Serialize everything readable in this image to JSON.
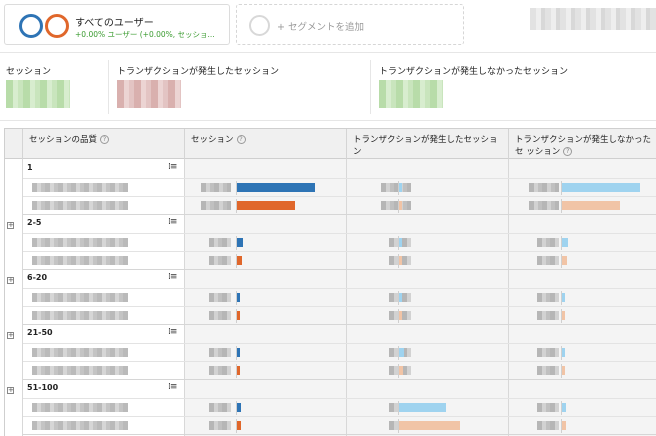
{
  "segments": {
    "active": {
      "name": "すべてのユーザー",
      "stats": "+0.00% ユーザー (+0.00%, セッショ...",
      "colors": [
        "#2e74b5",
        "#e0672b"
      ]
    },
    "add_label": "+ セグメントを追加"
  },
  "summary": [
    {
      "label": "セッション",
      "color": "green"
    },
    {
      "label": "トランザクションが発生したセッション",
      "color": "red"
    },
    {
      "label": "トランザクションが発生しなかったセッション",
      "color": "green"
    }
  ],
  "table": {
    "headers": [
      "セッションの品質",
      "セッション",
      "トランザクションが発生したセッション",
      "トランザクションが発生しなかったセ ッション"
    ],
    "help_icon": "?",
    "groups": [
      {
        "label": "1",
        "bars": {
          "sessions": [
            0.78,
            0.58
          ],
          "with_tx": [
            0.04,
            0.03
          ],
          "without_tx": [
            0.78,
            0.58
          ]
        }
      },
      {
        "label": "2-5",
        "bars": {
          "sessions": [
            0.06,
            0.05
          ],
          "with_tx": [
            0.02,
            0.02
          ],
          "without_tx": [
            0.06,
            0.05
          ]
        }
      },
      {
        "label": "6-20",
        "bars": {
          "sessions": [
            0.03,
            0.03
          ],
          "with_tx": [
            0.02,
            0.02
          ],
          "without_tx": [
            0.03,
            0.03
          ]
        }
      },
      {
        "label": "21-50",
        "bars": {
          "sessions": [
            0.03,
            0.03
          ],
          "with_tx": [
            0.06,
            0.05
          ],
          "without_tx": [
            0.03,
            0.03
          ]
        }
      },
      {
        "label": "51-100",
        "bars": {
          "sessions": [
            0.04,
            0.04
          ],
          "with_tx": [
            0.6,
            0.78
          ],
          "without_tx": [
            0.04,
            0.04
          ]
        }
      }
    ],
    "colors": {
      "blue_dark": "#2e74b5",
      "orange_dark": "#e0672b",
      "blue_light": "#9fd3ef",
      "orange_light": "#f1c4a6"
    }
  }
}
